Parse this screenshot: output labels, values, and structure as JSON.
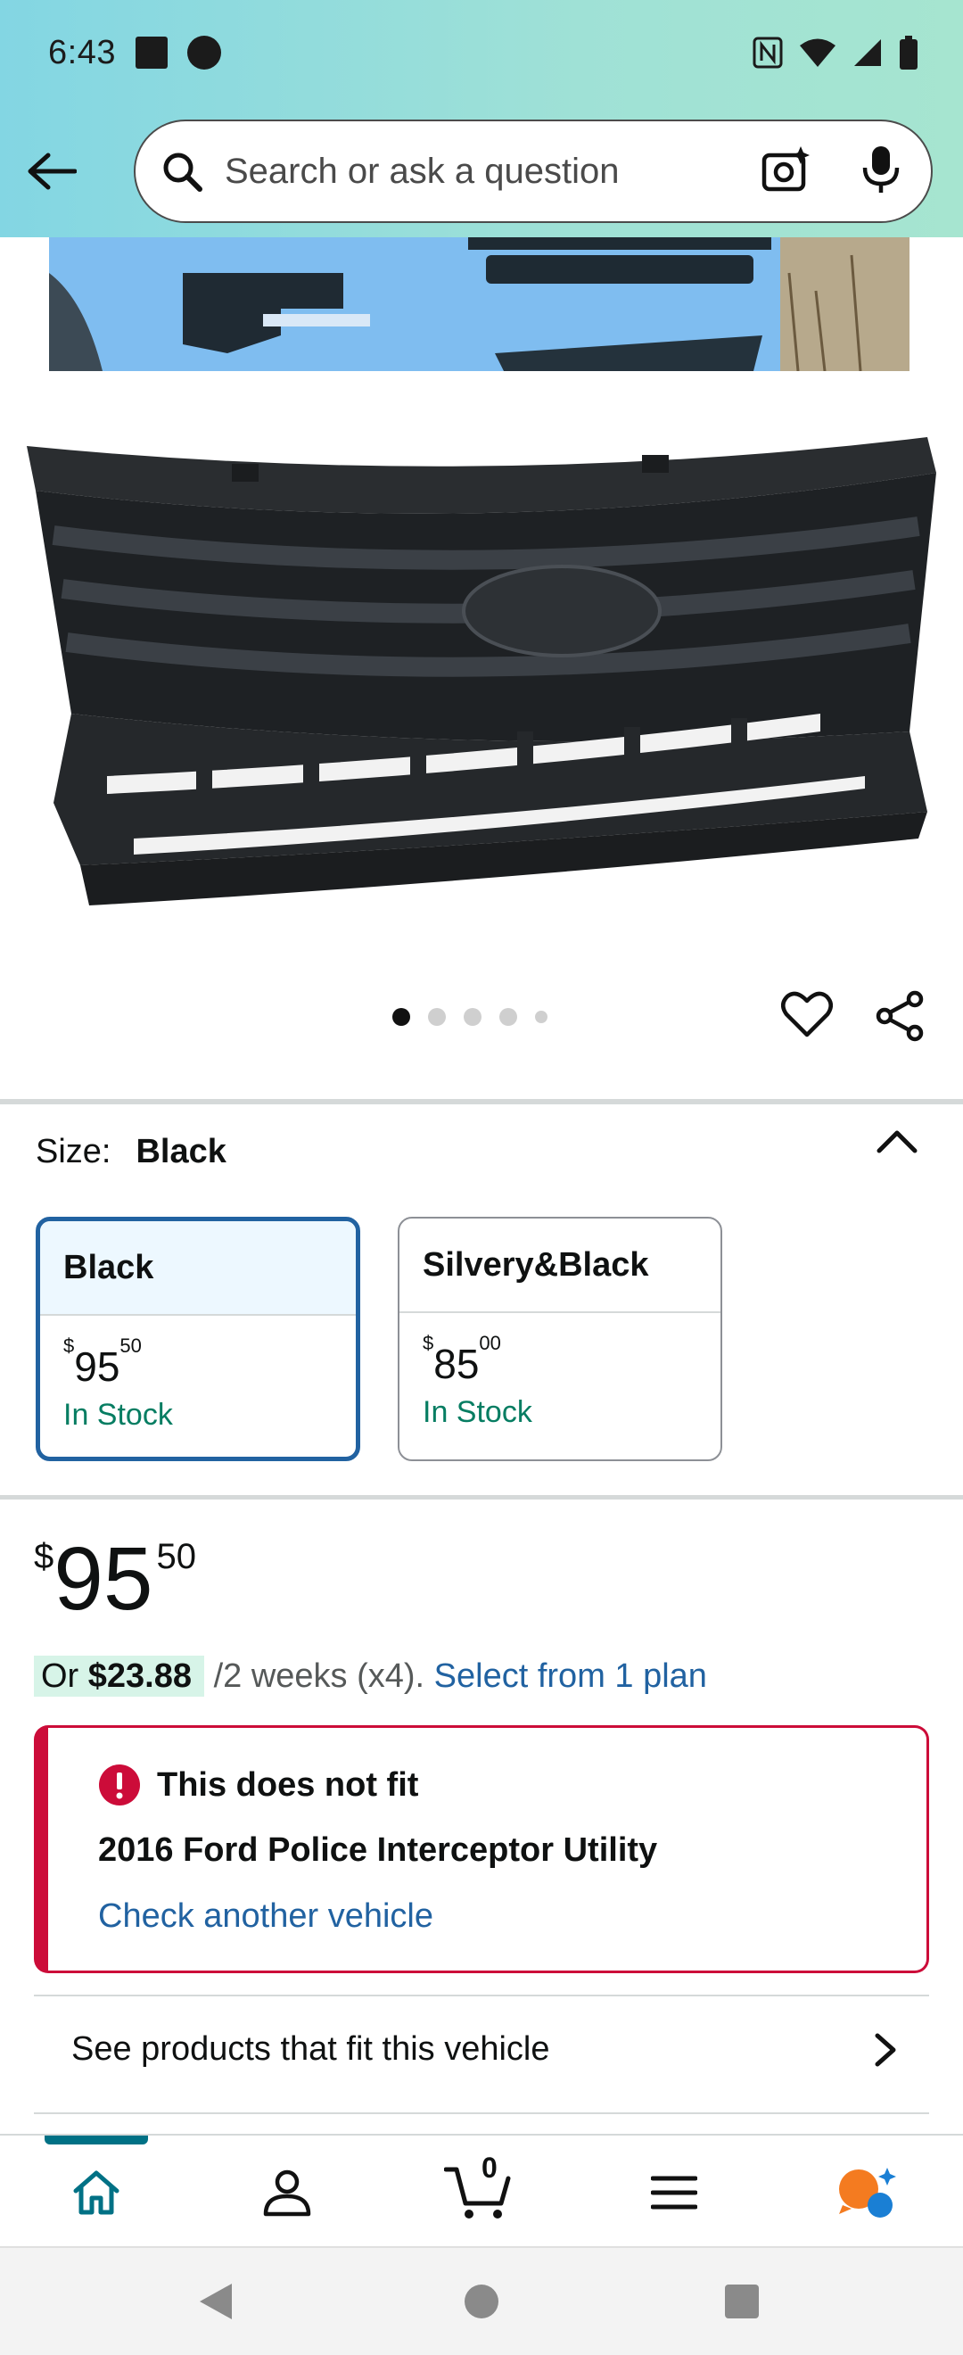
{
  "status_bar": {
    "time": "6:43"
  },
  "search": {
    "placeholder": "Search or ask a question"
  },
  "carousel": {
    "total": 5,
    "active_index": 0
  },
  "size": {
    "label": "Size:",
    "value": "Black",
    "options": [
      {
        "name": "Black",
        "price_dollars": "95",
        "price_cents": "50",
        "currency": "$",
        "stock": "In Stock",
        "selected": true
      },
      {
        "name": "Silvery&Black",
        "price_dollars": "85",
        "price_cents": "00",
        "currency": "$",
        "stock": "In Stock",
        "selected": false
      }
    ]
  },
  "price": {
    "currency": "$",
    "dollars": "95",
    "cents": "50"
  },
  "plan": {
    "or": "Or",
    "amount": "$23.88",
    "terms": "/2 weeks (x4).",
    "link": "Select from 1 plan"
  },
  "fitment": {
    "title": "This does not fit",
    "vehicle": "2016 Ford Police Interceptor Utility",
    "link": "Check another vehicle"
  },
  "see_products": {
    "label": "See products that fit this vehicle"
  },
  "bottom_nav": {
    "cart_count": "0"
  },
  "colors": {
    "accent_blue": "#2162a1",
    "in_stock_green": "#067d62",
    "error_red": "#cc0c39",
    "nav_teal": "#007185"
  }
}
